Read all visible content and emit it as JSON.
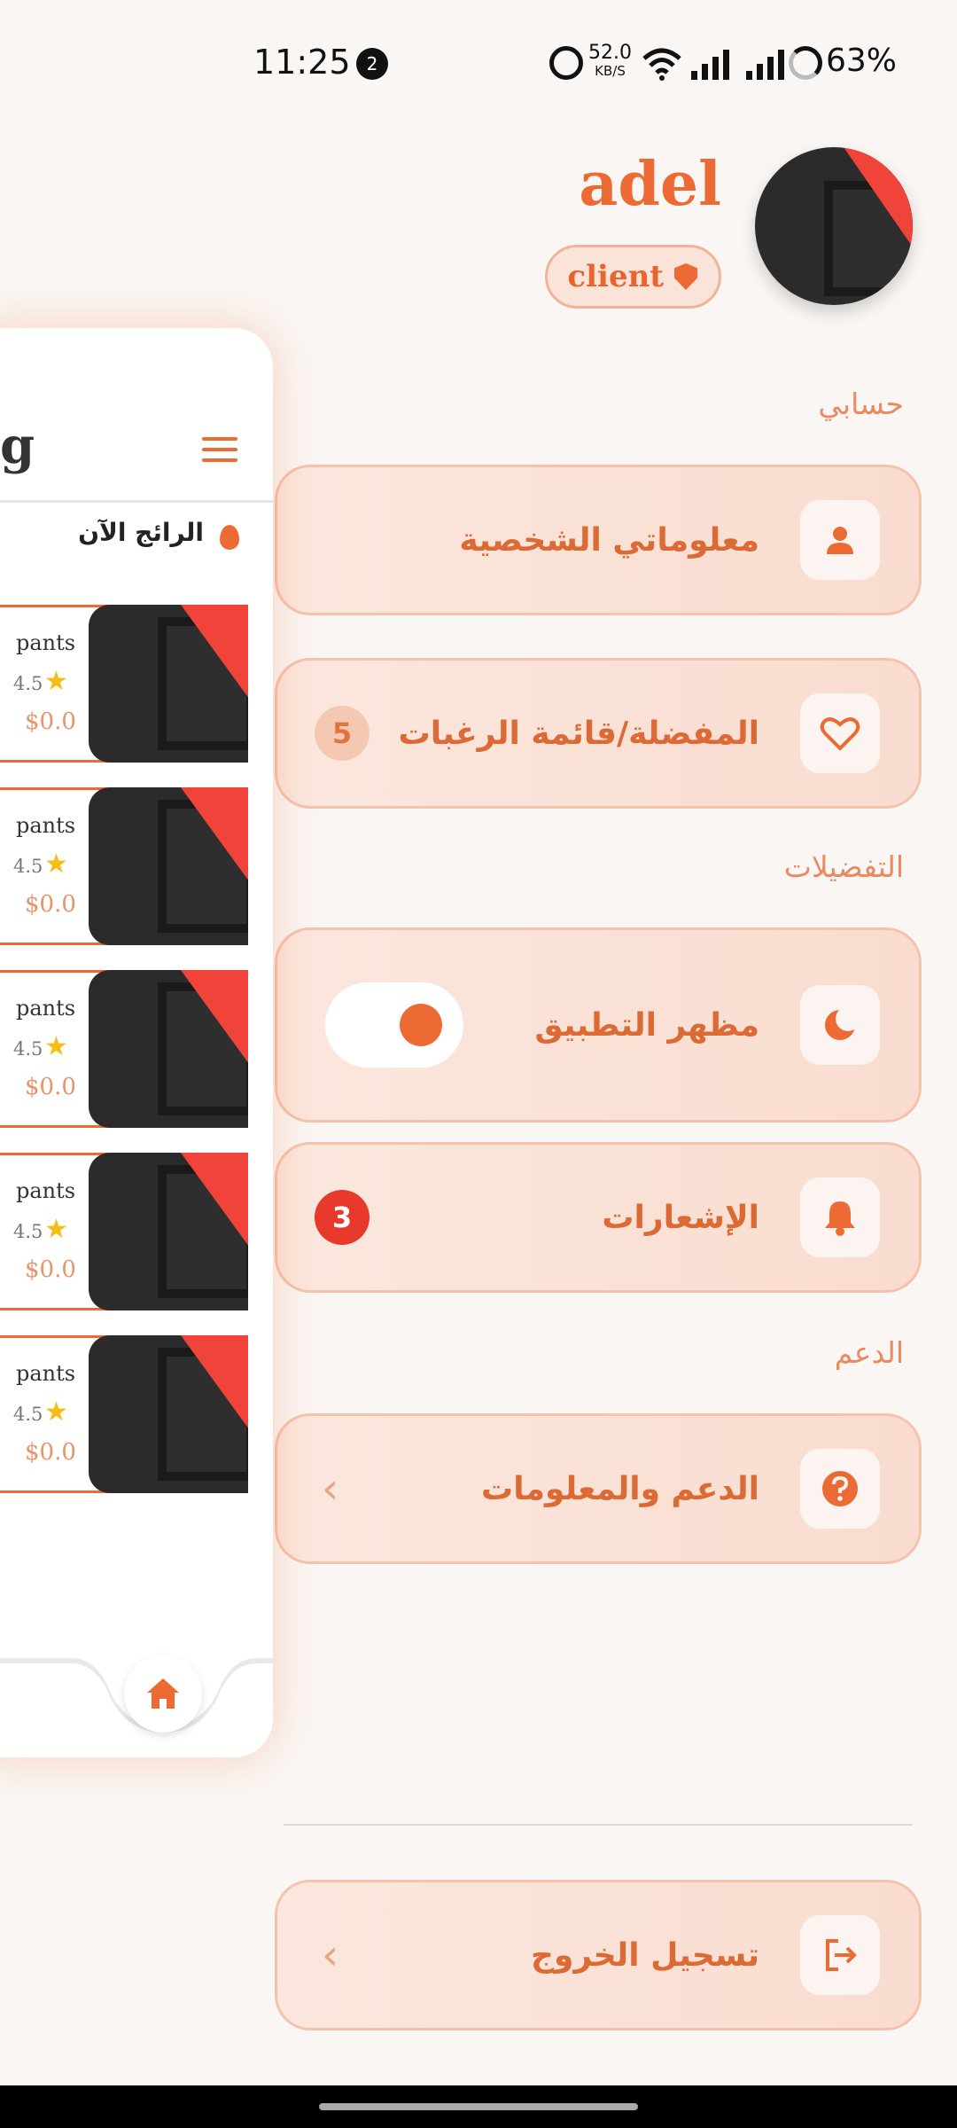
{
  "status_bar": {
    "time": "11:25",
    "notification_count": "2",
    "net_speed": "52.0",
    "net_unit": "KB/S",
    "battery": "63%"
  },
  "profile": {
    "name": "adel",
    "role": "client"
  },
  "sections": {
    "account": "حسابي",
    "preferences": "التفضيلات",
    "support": "الدعم"
  },
  "menu": {
    "personal_info": "معلوماتي الشخصية",
    "wishlist": "المفضلة/قائمة الرغبات",
    "wishlist_count": "5",
    "appearance": "مظهر التطبيق",
    "dark_mode_on": true,
    "notifications": "الإشعارات",
    "notifications_count": "3",
    "help": "الدعم والمعلومات",
    "logout": "تسجيل الخروج"
  },
  "preview": {
    "title_partial": "g",
    "trending": "الرائج الآن",
    "products": [
      {
        "name": "pants",
        "rating": "4.5",
        "price": "$0.0"
      },
      {
        "name": "pants",
        "rating": "4.5",
        "price": "$0.0"
      },
      {
        "name": "pants",
        "rating": "4.5",
        "price": "$0.0"
      },
      {
        "name": "pants",
        "rating": "4.5",
        "price": "$0.0"
      },
      {
        "name": "pants",
        "rating": "4.5",
        "price": "$0.0"
      }
    ]
  },
  "colors": {
    "accent": "#ec6a33",
    "badge_red": "#e8392d",
    "star": "#f6bd16"
  }
}
